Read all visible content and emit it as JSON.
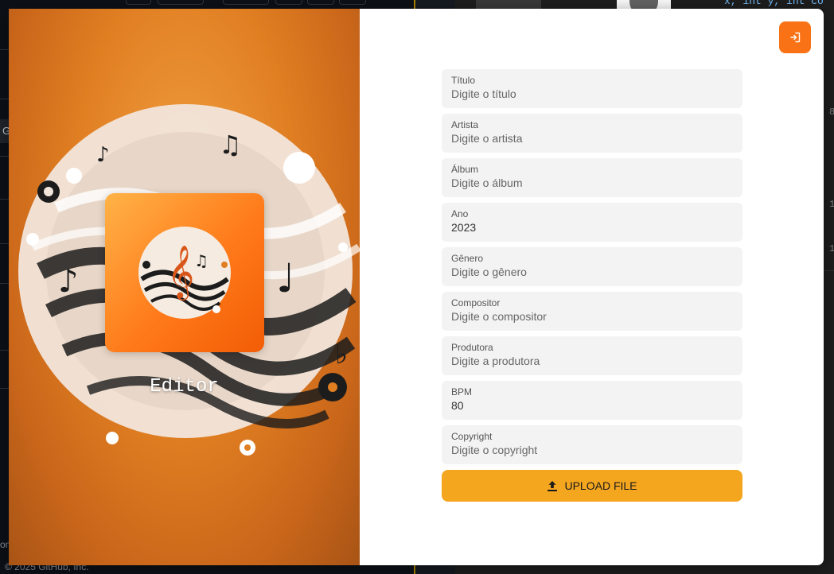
{
  "background": {
    "code_snippet": "x, int y, int co",
    "footer": "© 2025 GitHub, Inc.",
    "left_fragment_g": "G",
    "left_fragment_on": "on",
    "line_numbers": [
      "8",
      "1",
      "1"
    ]
  },
  "modal": {
    "editor_label": "Editor",
    "exit_icon": "exit-icon",
    "fields": [
      {
        "label": "Título",
        "value": "",
        "placeholder": "Digite o título"
      },
      {
        "label": "Artista",
        "value": "",
        "placeholder": "Digite o artista"
      },
      {
        "label": "Álbum",
        "value": "",
        "placeholder": "Digite o álbum"
      },
      {
        "label": "Ano",
        "value": "2023",
        "placeholder": ""
      },
      {
        "label": "Gênero",
        "value": "",
        "placeholder": "Digite o gênero"
      },
      {
        "label": "Compositor",
        "value": "",
        "placeholder": "Digite o compositor"
      },
      {
        "label": "Produtora",
        "value": "",
        "placeholder": "Digite a produtora"
      },
      {
        "label": "BPM",
        "value": "80",
        "placeholder": ""
      },
      {
        "label": "Copyright",
        "value": "",
        "placeholder": "Digite o copyright"
      }
    ],
    "upload": {
      "label": "UPLOAD FILE",
      "icon": "upload-icon"
    }
  },
  "colors": {
    "accent": "#f97316",
    "upload_button": "#f4a61f",
    "field_bg": "#f3f3f3"
  }
}
